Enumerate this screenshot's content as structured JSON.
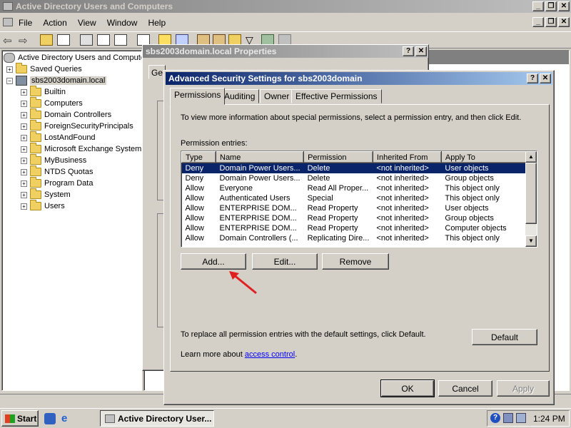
{
  "mmc": {
    "title": "Active Directory Users and Computers",
    "menu": [
      "File",
      "Action",
      "View",
      "Window",
      "Help"
    ]
  },
  "tree": {
    "root": "Active Directory Users and Compute",
    "saved_queries": "Saved Queries",
    "domain": "sbs2003domain.local",
    "children": [
      "Builtin",
      "Computers",
      "Domain Controllers",
      "ForeignSecurityPrincipals",
      "LostAndFound",
      "Microsoft Exchange System",
      "MyBusiness",
      "NTDS Quotas",
      "Program Data",
      "System",
      "Users"
    ]
  },
  "properties_dialog": {
    "title": "sbs2003domain.local Properties",
    "partial_tab": "Ge"
  },
  "advanced": {
    "title": "Advanced Security Settings for sbs2003domain",
    "tabs": [
      "Permissions",
      "Auditing",
      "Owner",
      "Effective Permissions"
    ],
    "info_text": "To view more information about special permissions, select a permission entry, and then click Edit.",
    "entries_label": "Permission entries:",
    "columns": [
      "Type",
      "Name",
      "Permission",
      "Inherited From",
      "Apply To"
    ],
    "rows": [
      [
        "Deny",
        "Domain Power Users...",
        "Delete",
        "<not inherited>",
        "User objects"
      ],
      [
        "Deny",
        "Domain Power Users...",
        "Delete",
        "<not inherited>",
        "Group objects"
      ],
      [
        "Allow",
        "Everyone",
        "Read All Proper...",
        "<not inherited>",
        "This object only"
      ],
      [
        "Allow",
        "Authenticated Users",
        "Special",
        "<not inherited>",
        "This object only"
      ],
      [
        "Allow",
        "ENTERPRISE DOM...",
        "Read Property",
        "<not inherited>",
        "User objects"
      ],
      [
        "Allow",
        "ENTERPRISE DOM...",
        "Read Property",
        "<not inherited>",
        "Group objects"
      ],
      [
        "Allow",
        "ENTERPRISE DOM...",
        "Read Property",
        "<not inherited>",
        "Computer objects"
      ],
      [
        "Allow",
        "Domain Controllers (...",
        "Replicating Dire...",
        "<not inherited>",
        "This object only"
      ]
    ],
    "add_label": "Add...",
    "edit_label": "Edit...",
    "remove_label": "Remove",
    "default_text": "To replace all permission entries with the default settings, click Default.",
    "default_label": "Default",
    "learn_prefix": "Learn more about ",
    "learn_link": "access control",
    "learn_suffix": ".",
    "ok_label": "OK",
    "cancel_label": "Cancel",
    "apply_label": "Apply"
  },
  "taskbar": {
    "start_label": "Start",
    "task_label": "Active Directory User...",
    "clock": "1:24 PM"
  },
  "colors": {
    "title_active": "#0a246a",
    "selection": "#0a246a",
    "annotation_arrow": "#e02020"
  }
}
